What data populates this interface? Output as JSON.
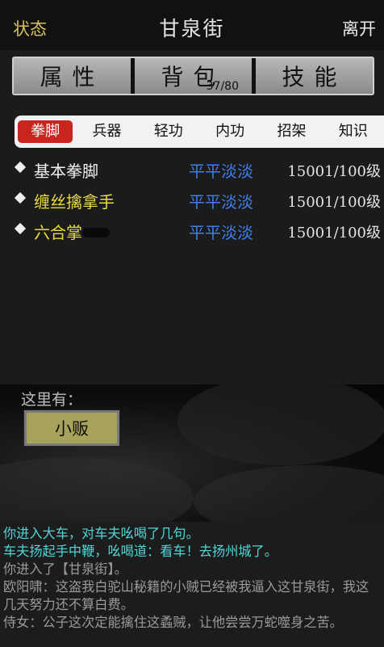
{
  "topbar": {
    "status": "状态",
    "title": "甘泉街",
    "leave": "离开"
  },
  "main_tabs": [
    {
      "label": "属性"
    },
    {
      "label": "背包",
      "count": "37/80"
    },
    {
      "label": "技能"
    }
  ],
  "sub_tabs": [
    "拳脚",
    "兵器",
    "轻功",
    "内功",
    "招架",
    "知识"
  ],
  "active_sub_tab": "拳脚",
  "skills": [
    {
      "name": "基本拳脚",
      "level_desc": "平平淡淡",
      "level": "15001/100级",
      "color": "#f0f0f0"
    },
    {
      "name": "缠丝擒拿手",
      "level_desc": "平平淡淡",
      "level": "15001/100级",
      "color": "#e6d94a"
    },
    {
      "name": "六合掌",
      "level_desc": "平平淡淡",
      "level": "15001/100级",
      "color": "#e6d94a"
    }
  ],
  "scene": {
    "here_label": "这里有：",
    "npc": "小贩"
  },
  "log": [
    {
      "text": "你进入大车，对车夫吆喝了几句。",
      "color": "cyan"
    },
    {
      "text": "车夫扬起手中鞭，吆喝道：看车！去扬州城了。",
      "color": "cyan"
    },
    {
      "text": "你进入了【甘泉街】。",
      "color": "gray"
    },
    {
      "text": "欧阳啸：这盗我白驼山秘籍的小贼已经被我逼入这甘泉街，我这几天努力还不算白费。",
      "color": "gray"
    },
    {
      "text": "侍女：公子这次定能擒住这蟊贼，让他尝尝万蛇噬身之苦。",
      "color": "gray"
    }
  ]
}
